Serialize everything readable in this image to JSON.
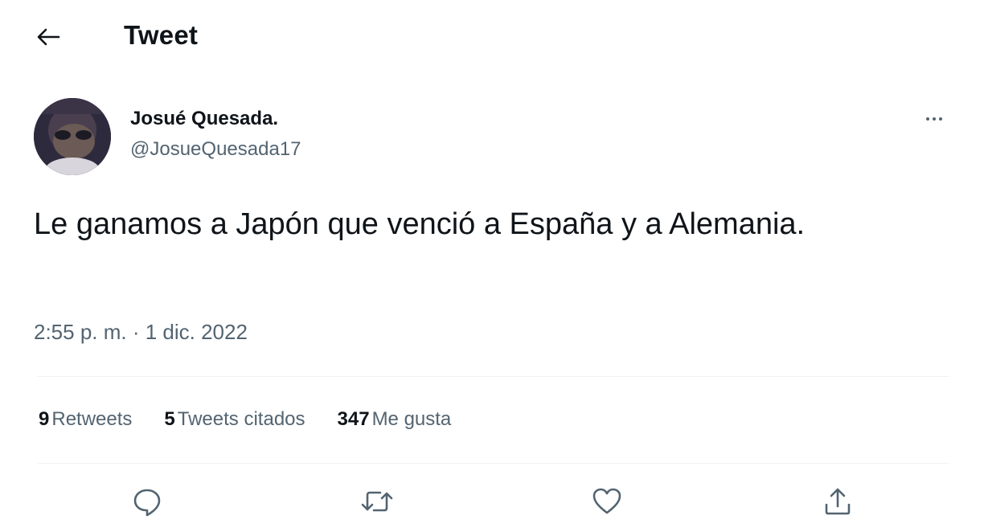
{
  "header": {
    "title": "Tweet",
    "back_icon": "arrow-left-icon"
  },
  "author": {
    "name": "Josué Quesada.",
    "handle": "@JosueQuesada17"
  },
  "tweet": {
    "text": "Le ganamos a Japón que venció a España y a Alemania.",
    "timestamp": "2:55 p. m. · 1 dic. 2022"
  },
  "stats": {
    "retweets_count": "9",
    "retweets_label": "Retweets",
    "quotes_count": "5",
    "quotes_label": "Tweets citados",
    "likes_count": "347",
    "likes_label": "Me gusta"
  },
  "actions": {
    "reply_icon": "reply-bubble-icon",
    "retweet_icon": "retweet-icon",
    "like_icon": "heart-icon",
    "share_icon": "share-upload-icon"
  },
  "colors": {
    "text_primary": "#0f1419",
    "text_secondary": "#536471",
    "divider": "#eff3f4",
    "background": "#ffffff"
  }
}
